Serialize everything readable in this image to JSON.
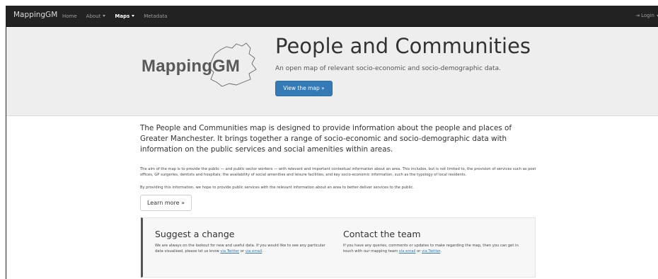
{
  "navbar": {
    "brand": "MappingGM",
    "items": [
      {
        "label": "Home",
        "dropdown": false,
        "active": false
      },
      {
        "label": "About",
        "dropdown": true,
        "active": false
      },
      {
        "label": "Maps",
        "dropdown": true,
        "active": true
      },
      {
        "label": "Metadata",
        "dropdown": false,
        "active": false
      }
    ],
    "login_label": "Login",
    "login_icon": "sign-in-icon"
  },
  "hero": {
    "logo_text": "MappingGM",
    "title": "People and Communities",
    "subtitle": "An open map of relevant socio-economic and socio-demographic data.",
    "button_label": "View the map »",
    "button_color": "#337ab7",
    "background": "#eeeeee"
  },
  "main": {
    "intro": "The People and Communities map is designed to provide information about the people and places of Greater Manchester. It brings together a range of socio-economic and socio-demographic data with information on the public services and social amenities within areas.",
    "paragraph1": "The aim of the map is to provide the public — and public sector workers — with relevant and important contextual information about an area. This includes, but is not limited to, the provision of services such as post offices, GP surgeries, dentists and hospitals; the availability of social amenities and leisure facilities; and key socio-economic information, such as the typology of local residents.",
    "paragraph2": "By providing this information, we hope to provide public services with the relevant information about an area to better deliver services to the public.",
    "learn_more": "Learn more »"
  },
  "panel": {
    "suggest": {
      "title": "Suggest a change",
      "text": "We are always on the lookout for new and useful data. If you would like to see any particular data visualised, please let us know",
      "link1": "via Twitter",
      "joiner": "or",
      "link2": "via email",
      "end": "."
    },
    "contact": {
      "title": "Contact the team",
      "text": "If you have any queries, comments or updates to make regarding the map, then you can get in touch with our mapping team",
      "link1": "via email",
      "joiner": "or",
      "link2": "via Twitter",
      "end": "."
    }
  }
}
